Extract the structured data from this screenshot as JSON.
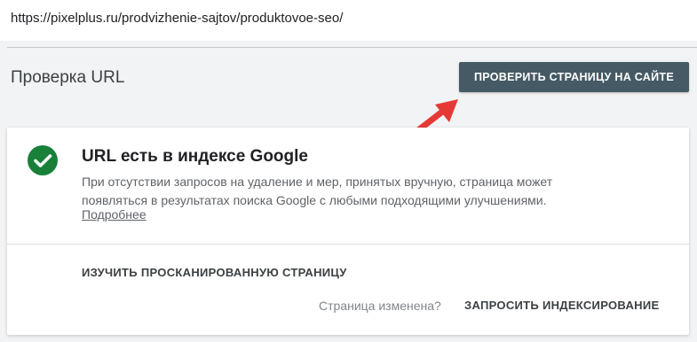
{
  "address_bar": {
    "url": "https://pixelplus.ru/prodvizhenie-sajtov/produktovoe-seo/"
  },
  "header": {
    "title": "Проверка URL",
    "test_live_label": "ПРОВЕРИТЬ СТРАНИЦУ НА САЙТЕ"
  },
  "status_card": {
    "icon": "check-circle-icon",
    "icon_color": "#188038",
    "title": "URL есть в индексе Google",
    "description": "При отсутствии запросов на удаление и мер, принятых вручную, страница может появляться в результатах поиска Google с любыми подходящими улучшениями.",
    "learn_more": "Подробнее",
    "inspect_label": "ИЗУЧИТЬ ПРОСКАНИРОВАННУЮ СТРАНИЦУ",
    "page_changed": "Страница изменена?",
    "request_indexing_label": "ЗАПРОСИТЬ ИНДЕКСИРОВАНИЕ"
  },
  "colors": {
    "button_bg": "#455a64",
    "arrow": "#e53935"
  }
}
